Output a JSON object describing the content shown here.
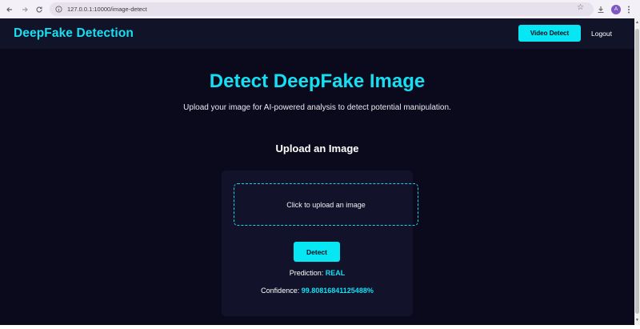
{
  "browser": {
    "url": "127.0.0.1:10000/image-detect",
    "profile_initial": "A",
    "icons": [
      "back-arrow-icon",
      "forward-arrow-icon",
      "reload-icon",
      "site-info-icon",
      "bookmark-star-icon",
      "download-icon",
      "more-vert-icon"
    ]
  },
  "navbar": {
    "brand": "DeepFake Detection",
    "video_detect_label": "Video Detect",
    "logout_label": "Logout"
  },
  "main": {
    "title": "Detect DeepFake Image",
    "subtitle": "Upload your image for AI-powered analysis to detect potential manipulation.",
    "upload_heading": "Upload an Image",
    "dropzone_text": "Click to upload an image",
    "detect_label": "Detect",
    "prediction_label": "Prediction:",
    "prediction_value": "REAL",
    "confidence_label": "Confidence:",
    "confidence_value": "99.80816841125488%"
  },
  "colors": {
    "accent": "#16dff2",
    "background": "#0b0a1c",
    "navbar": "#111329",
    "card": "#12122b",
    "button": "#06e6f3"
  }
}
